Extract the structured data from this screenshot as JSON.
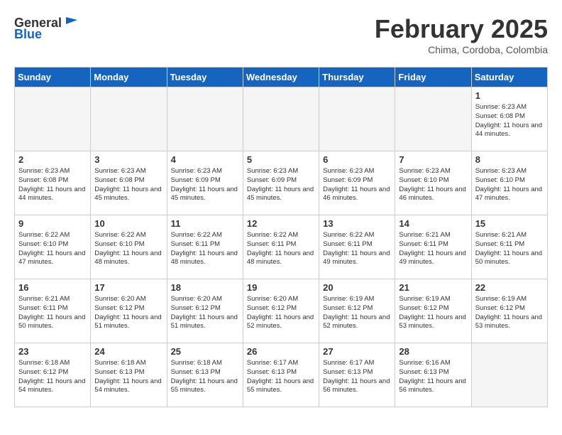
{
  "header": {
    "logo_general": "General",
    "logo_blue": "Blue",
    "month_title": "February 2025",
    "subtitle": "Chima, Cordoba, Colombia"
  },
  "days_of_week": [
    "Sunday",
    "Monday",
    "Tuesday",
    "Wednesday",
    "Thursday",
    "Friday",
    "Saturday"
  ],
  "weeks": [
    [
      {
        "day": "",
        "sunrise": "",
        "sunset": "",
        "daylight": "",
        "empty": true
      },
      {
        "day": "",
        "sunrise": "",
        "sunset": "",
        "daylight": "",
        "empty": true
      },
      {
        "day": "",
        "sunrise": "",
        "sunset": "",
        "daylight": "",
        "empty": true
      },
      {
        "day": "",
        "sunrise": "",
        "sunset": "",
        "daylight": "",
        "empty": true
      },
      {
        "day": "",
        "sunrise": "",
        "sunset": "",
        "daylight": "",
        "empty": true
      },
      {
        "day": "",
        "sunrise": "",
        "sunset": "",
        "daylight": "",
        "empty": true
      },
      {
        "day": "1",
        "sunrise": "6:23 AM",
        "sunset": "6:08 PM",
        "daylight": "11 hours and 44 minutes.",
        "empty": false
      }
    ],
    [
      {
        "day": "2",
        "sunrise": "6:23 AM",
        "sunset": "6:08 PM",
        "daylight": "11 hours and 44 minutes.",
        "empty": false
      },
      {
        "day": "3",
        "sunrise": "6:23 AM",
        "sunset": "6:08 PM",
        "daylight": "11 hours and 45 minutes.",
        "empty": false
      },
      {
        "day": "4",
        "sunrise": "6:23 AM",
        "sunset": "6:09 PM",
        "daylight": "11 hours and 45 minutes.",
        "empty": false
      },
      {
        "day": "5",
        "sunrise": "6:23 AM",
        "sunset": "6:09 PM",
        "daylight": "11 hours and 45 minutes.",
        "empty": false
      },
      {
        "day": "6",
        "sunrise": "6:23 AM",
        "sunset": "6:09 PM",
        "daylight": "11 hours and 46 minutes.",
        "empty": false
      },
      {
        "day": "7",
        "sunrise": "6:23 AM",
        "sunset": "6:10 PM",
        "daylight": "11 hours and 46 minutes.",
        "empty": false
      },
      {
        "day": "8",
        "sunrise": "6:23 AM",
        "sunset": "6:10 PM",
        "daylight": "11 hours and 47 minutes.",
        "empty": false
      }
    ],
    [
      {
        "day": "9",
        "sunrise": "6:22 AM",
        "sunset": "6:10 PM",
        "daylight": "11 hours and 47 minutes.",
        "empty": false
      },
      {
        "day": "10",
        "sunrise": "6:22 AM",
        "sunset": "6:10 PM",
        "daylight": "11 hours and 48 minutes.",
        "empty": false
      },
      {
        "day": "11",
        "sunrise": "6:22 AM",
        "sunset": "6:11 PM",
        "daylight": "11 hours and 48 minutes.",
        "empty": false
      },
      {
        "day": "12",
        "sunrise": "6:22 AM",
        "sunset": "6:11 PM",
        "daylight": "11 hours and 48 minutes.",
        "empty": false
      },
      {
        "day": "13",
        "sunrise": "6:22 AM",
        "sunset": "6:11 PM",
        "daylight": "11 hours and 49 minutes.",
        "empty": false
      },
      {
        "day": "14",
        "sunrise": "6:21 AM",
        "sunset": "6:11 PM",
        "daylight": "11 hours and 49 minutes.",
        "empty": false
      },
      {
        "day": "15",
        "sunrise": "6:21 AM",
        "sunset": "6:11 PM",
        "daylight": "11 hours and 50 minutes.",
        "empty": false
      }
    ],
    [
      {
        "day": "16",
        "sunrise": "6:21 AM",
        "sunset": "6:11 PM",
        "daylight": "11 hours and 50 minutes.",
        "empty": false
      },
      {
        "day": "17",
        "sunrise": "6:20 AM",
        "sunset": "6:12 PM",
        "daylight": "11 hours and 51 minutes.",
        "empty": false
      },
      {
        "day": "18",
        "sunrise": "6:20 AM",
        "sunset": "6:12 PM",
        "daylight": "11 hours and 51 minutes.",
        "empty": false
      },
      {
        "day": "19",
        "sunrise": "6:20 AM",
        "sunset": "6:12 PM",
        "daylight": "11 hours and 52 minutes.",
        "empty": false
      },
      {
        "day": "20",
        "sunrise": "6:19 AM",
        "sunset": "6:12 PM",
        "daylight": "11 hours and 52 minutes.",
        "empty": false
      },
      {
        "day": "21",
        "sunrise": "6:19 AM",
        "sunset": "6:12 PM",
        "daylight": "11 hours and 53 minutes.",
        "empty": false
      },
      {
        "day": "22",
        "sunrise": "6:19 AM",
        "sunset": "6:12 PM",
        "daylight": "11 hours and 53 minutes.",
        "empty": false
      }
    ],
    [
      {
        "day": "23",
        "sunrise": "6:18 AM",
        "sunset": "6:12 PM",
        "daylight": "11 hours and 54 minutes.",
        "empty": false
      },
      {
        "day": "24",
        "sunrise": "6:18 AM",
        "sunset": "6:13 PM",
        "daylight": "11 hours and 54 minutes.",
        "empty": false
      },
      {
        "day": "25",
        "sunrise": "6:18 AM",
        "sunset": "6:13 PM",
        "daylight": "11 hours and 55 minutes.",
        "empty": false
      },
      {
        "day": "26",
        "sunrise": "6:17 AM",
        "sunset": "6:13 PM",
        "daylight": "11 hours and 55 minutes.",
        "empty": false
      },
      {
        "day": "27",
        "sunrise": "6:17 AM",
        "sunset": "6:13 PM",
        "daylight": "11 hours and 56 minutes.",
        "empty": false
      },
      {
        "day": "28",
        "sunrise": "6:16 AM",
        "sunset": "6:13 PM",
        "daylight": "11 hours and 56 minutes.",
        "empty": false
      },
      {
        "day": "",
        "sunrise": "",
        "sunset": "",
        "daylight": "",
        "empty": true
      }
    ]
  ]
}
